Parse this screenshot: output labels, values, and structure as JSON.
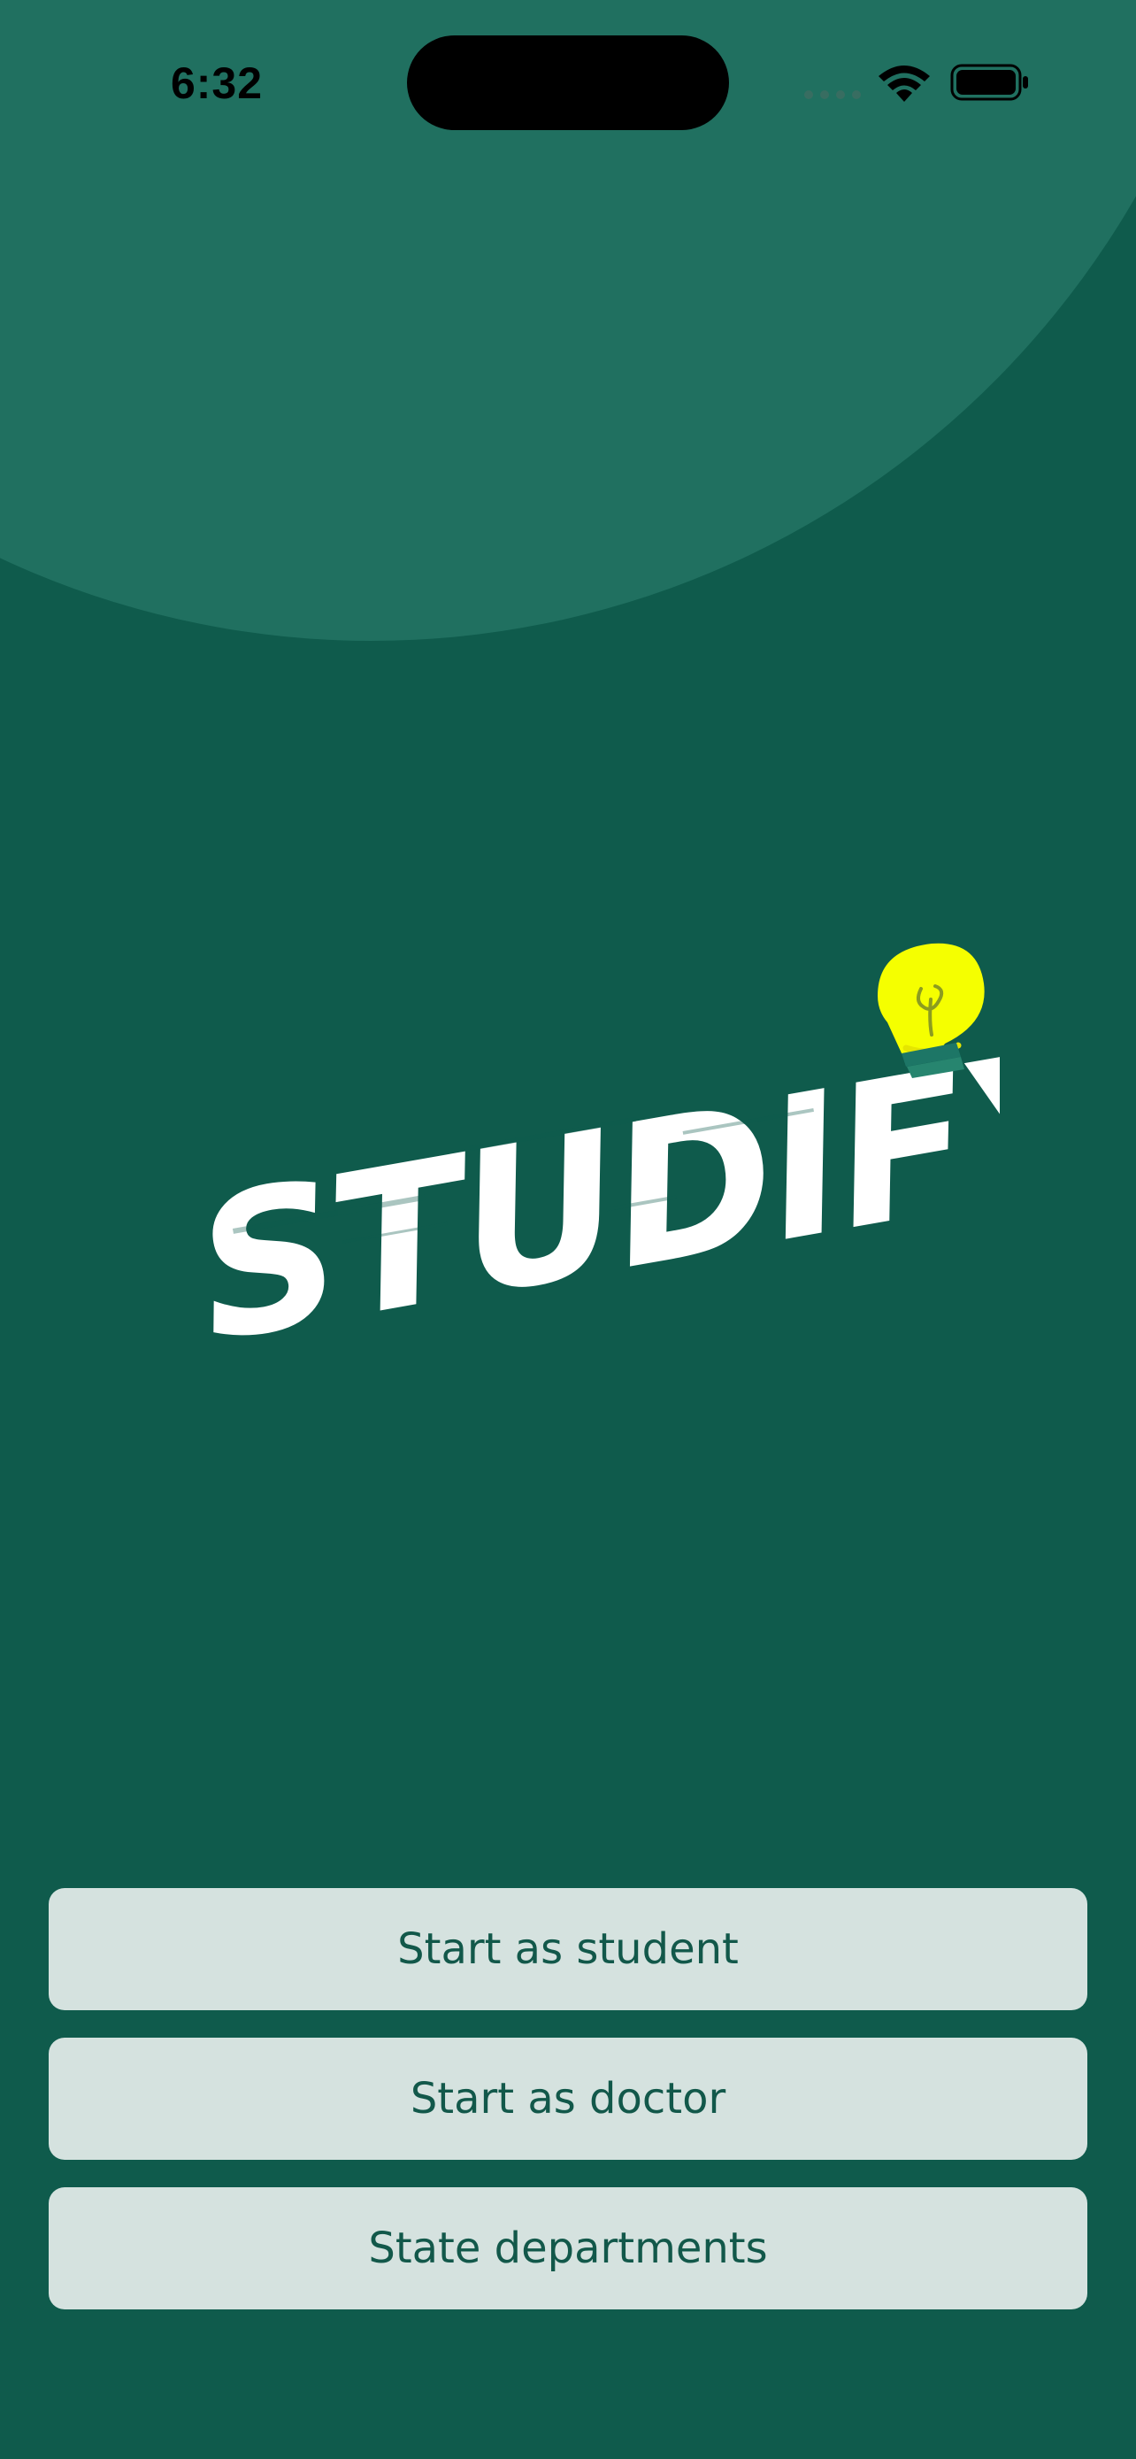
{
  "status_bar": {
    "time": "6:32",
    "icons": [
      "signal-dots-icon",
      "wifi-icon",
      "battery-icon"
    ]
  },
  "brand": {
    "name": "STUDIFY",
    "icon": "lightbulb-icon",
    "colors": {
      "background": "#0f5b4c",
      "background_circle": "#207060",
      "logo_text": "#ffffff",
      "bulb": "#f5ff00"
    }
  },
  "actions": [
    {
      "label": "Start as student"
    },
    {
      "label": "Start as doctor"
    },
    {
      "label": "State departments"
    }
  ],
  "theme": {
    "button_background": "#d5e2df",
    "button_text": "#12584a"
  }
}
